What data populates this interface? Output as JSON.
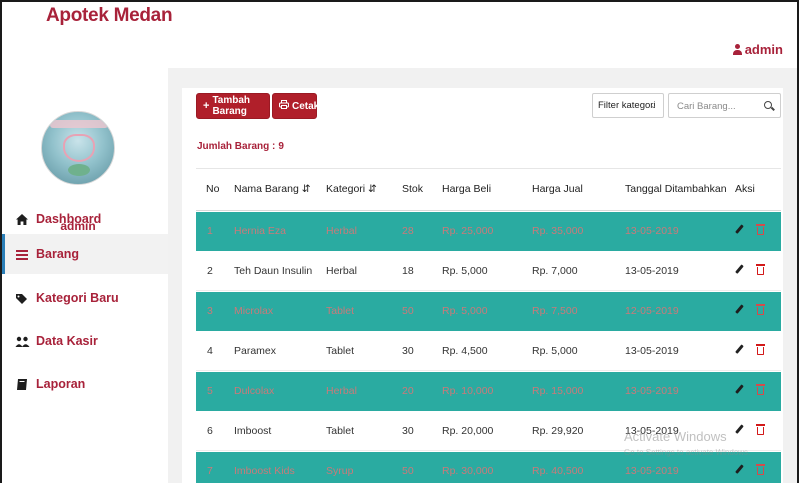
{
  "app": {
    "brand": "Apotek Medan"
  },
  "header": {
    "user_label": "admin",
    "user_icon": "user-icon"
  },
  "sidebar": {
    "username": "admin",
    "items": [
      {
        "label": "Dashboard",
        "icon": "home-icon",
        "active": false
      },
      {
        "label": "Barang",
        "icon": "bars-icon",
        "active": true
      },
      {
        "label": "Kategori Baru",
        "icon": "tags-icon",
        "active": false
      },
      {
        "label": "Data Kasir",
        "icon": "users-icon",
        "active": false
      },
      {
        "label": "Laporan",
        "icon": "book-icon",
        "active": false
      }
    ]
  },
  "toolbar": {
    "add_label": "Tambah Barang",
    "print_label": "Cetak",
    "count_label": "Jumlah Barang :",
    "count_value": "9",
    "filter_label": "Filter kategori",
    "search_placeholder": "Cari Barang..."
  },
  "table": {
    "headers": [
      "No",
      "Nama Barang",
      "Kategori",
      "Stok",
      "Harga Beli",
      "Harga Jual",
      "Tanggal Ditambahkan",
      "Aksi"
    ],
    "rows": [
      [
        "1",
        "Hernia Eza",
        "Herbal",
        "28",
        "Rp. 25,000",
        "Rp. 35,000",
        "13-05-2019"
      ],
      [
        "2",
        "Teh Daun Insulin",
        "Herbal",
        "18",
        "Rp. 5,000",
        "Rp. 7,000",
        "13-05-2019"
      ],
      [
        "3",
        "Microlax",
        "Tablet",
        "50",
        "Rp. 5,000",
        "Rp. 7,500",
        "12-05-2019"
      ],
      [
        "4",
        "Paramex",
        "Tablet",
        "30",
        "Rp. 4,500",
        "Rp. 5,000",
        "13-05-2019"
      ],
      [
        "5",
        "Dulcolax",
        "Herbal",
        "20",
        "Rp. 10,000",
        "Rp. 15,000",
        "13-05-2019"
      ],
      [
        "6",
        "Imboost",
        "Tablet",
        "30",
        "Rp. 20,000",
        "Rp. 29,920",
        "13-05-2019"
      ],
      [
        "7",
        "Imboost Kids",
        "Syrup",
        "50",
        "Rp. 30,000",
        "Rp. 40,500",
        "13-05-2019"
      ]
    ]
  },
  "watermark": {
    "title": "Activate Windows",
    "subtitle": "Go to Settings to activate Windows."
  },
  "colors": {
    "brand": "#a8223a",
    "button": "#b01f2a",
    "row_highlight": "#2aaba1",
    "active_border": "#2b7fb8"
  }
}
